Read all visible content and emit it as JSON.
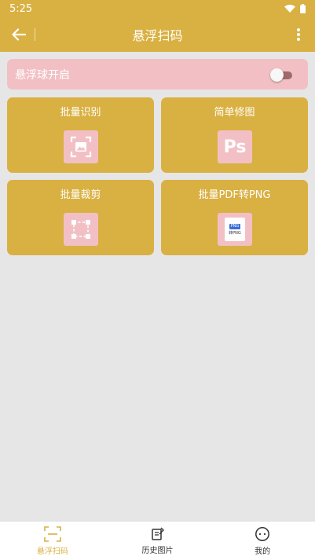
{
  "status_bar": {
    "time": "5:25"
  },
  "header": {
    "title": "悬浮扫码"
  },
  "floating_ball": {
    "label": "悬浮球开启",
    "enabled": false
  },
  "tools": [
    {
      "label": "批量识别",
      "icon": "image-scan-icon"
    },
    {
      "label": "简单修图",
      "icon": "ps-icon",
      "icon_text": "Ps"
    },
    {
      "label": "批量裁剪",
      "icon": "crop-frame-icon"
    },
    {
      "label": "批量PDF转PNG",
      "icon": "pdf-to-png-icon",
      "icon_text": "转PNG",
      "icon_badge": "PNG"
    }
  ],
  "bottom_nav": [
    {
      "label": "悬浮扫码",
      "icon": "scan-icon",
      "active": true
    },
    {
      "label": "历史图片",
      "icon": "history-images-icon",
      "active": false
    },
    {
      "label": "我的",
      "icon": "profile-icon",
      "active": false
    }
  ],
  "colors": {
    "primary": "#d9b042",
    "pink": "#f2c0c4",
    "background": "#e6e6e6"
  }
}
